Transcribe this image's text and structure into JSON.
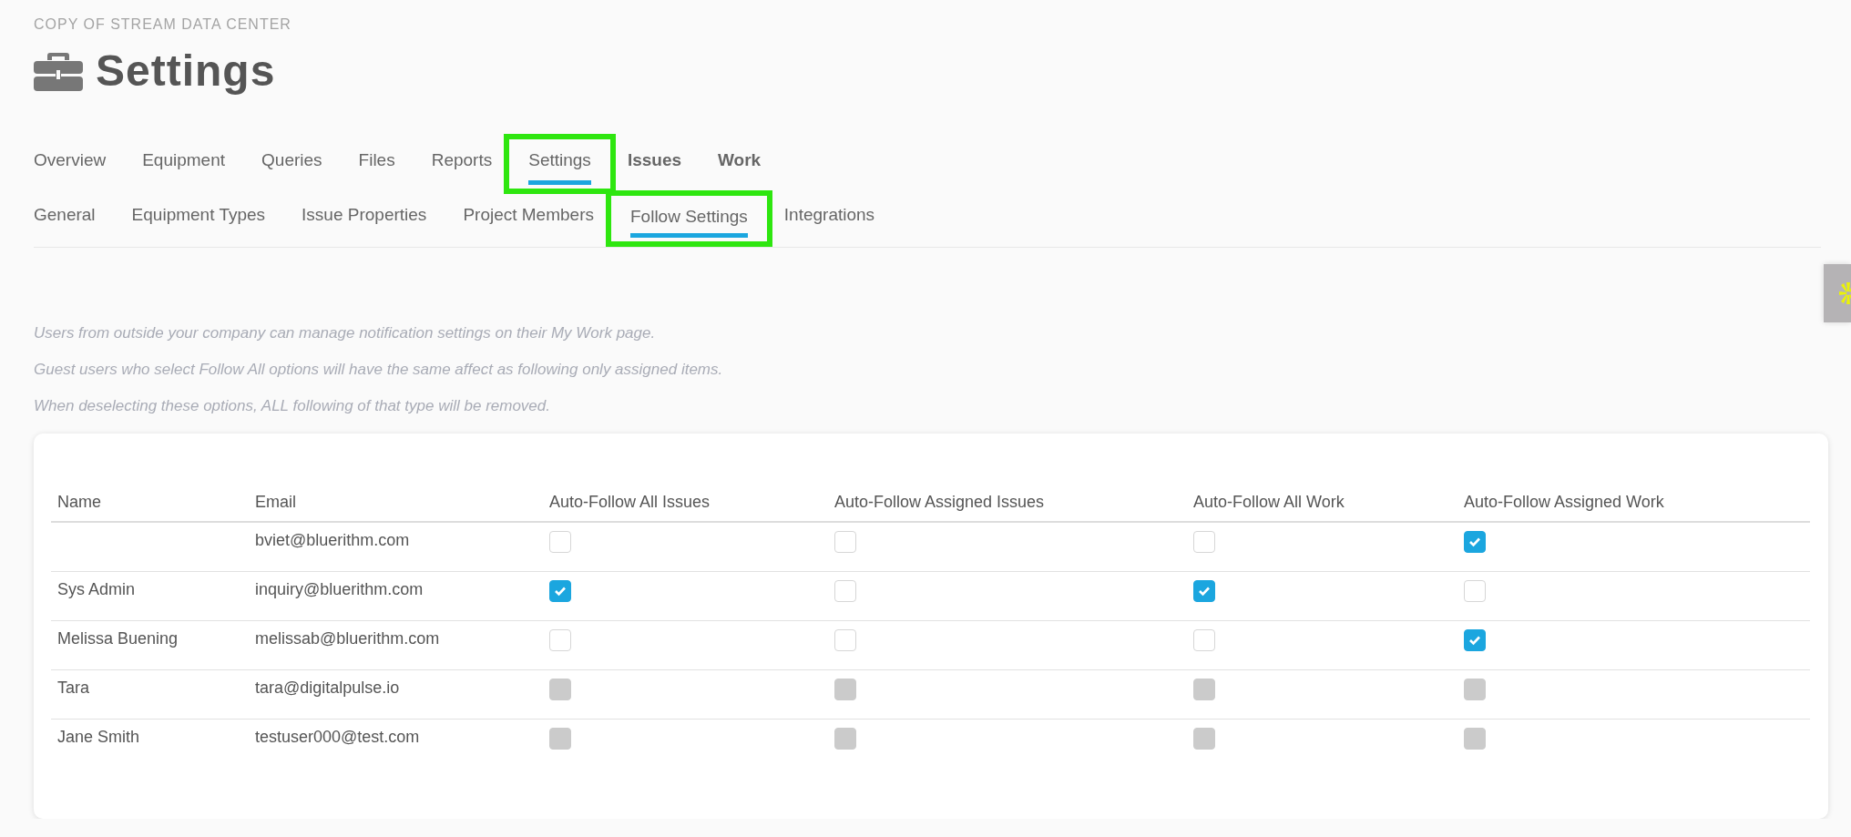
{
  "header": {
    "project": "COPY OF STREAM DATA CENTER",
    "title": "Settings"
  },
  "tabs": [
    {
      "label": "Overview",
      "selected": false,
      "bold": false,
      "highlighted": false
    },
    {
      "label": "Equipment",
      "selected": false,
      "bold": false,
      "highlighted": false
    },
    {
      "label": "Queries",
      "selected": false,
      "bold": false,
      "highlighted": false
    },
    {
      "label": "Files",
      "selected": false,
      "bold": false,
      "highlighted": false
    },
    {
      "label": "Reports",
      "selected": false,
      "bold": false,
      "highlighted": false
    },
    {
      "label": "Settings",
      "selected": true,
      "bold": false,
      "highlighted": true
    },
    {
      "label": "Issues",
      "selected": false,
      "bold": true,
      "highlighted": false
    },
    {
      "label": "Work",
      "selected": false,
      "bold": true,
      "highlighted": false
    }
  ],
  "subtabs": [
    {
      "label": "General",
      "selected": false,
      "highlighted": false
    },
    {
      "label": "Equipment Types",
      "selected": false,
      "highlighted": false
    },
    {
      "label": "Issue Properties",
      "selected": false,
      "highlighted": false
    },
    {
      "label": "Project Members",
      "selected": false,
      "highlighted": false
    },
    {
      "label": "Follow Settings",
      "selected": true,
      "highlighted": true
    },
    {
      "label": "Integrations",
      "selected": false,
      "highlighted": false
    }
  ],
  "notes": [
    "Users from outside your company can manage notification settings on their My Work page.",
    "Guest users who select Follow All options will have the same affect as following only assigned items.",
    "When deselecting these options, ALL following of that type will be removed."
  ],
  "table": {
    "columns": [
      "Name",
      "Email",
      "Auto-Follow All Issues",
      "Auto-Follow Assigned Issues",
      "Auto-Follow All Work",
      "Auto-Follow Assigned Work"
    ],
    "rows": [
      {
        "name": "",
        "email": "bviet@bluerithm.com",
        "disabled": false,
        "checks": [
          false,
          false,
          false,
          true
        ]
      },
      {
        "name": "Sys Admin",
        "email": "inquiry@bluerithm.com",
        "disabled": false,
        "checks": [
          true,
          false,
          true,
          false
        ]
      },
      {
        "name": "Melissa Buening",
        "email": "melissab@bluerithm.com",
        "disabled": false,
        "checks": [
          false,
          false,
          false,
          true
        ]
      },
      {
        "name": "Tara",
        "email": "tara@digitalpulse.io",
        "disabled": true,
        "checks": [
          false,
          false,
          false,
          false
        ]
      },
      {
        "name": "Jane Smith",
        "email": "testuser000@test.com",
        "disabled": true,
        "checks": [
          false,
          false,
          false,
          false
        ]
      }
    ]
  }
}
